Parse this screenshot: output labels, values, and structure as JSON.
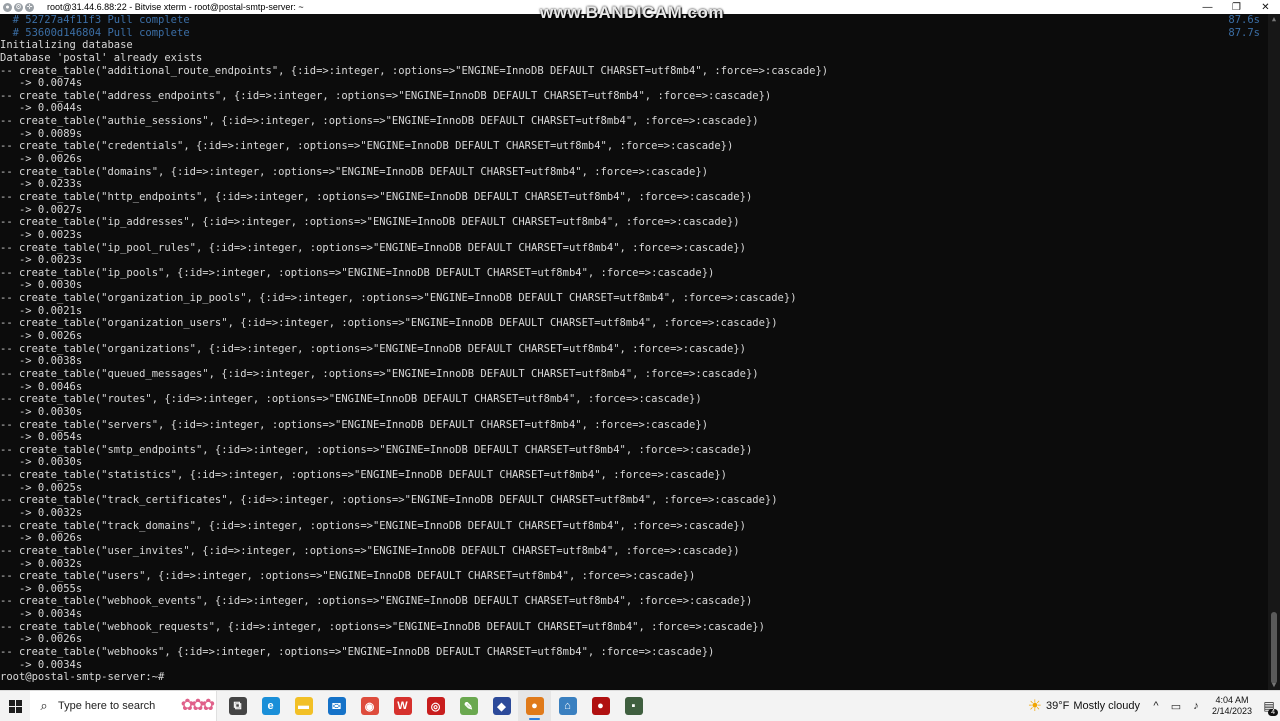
{
  "window": {
    "title": "root@31.44.6.88:22 - Bitvise xterm - root@postal-smtp-server: ~",
    "minimize": "—",
    "restore": "❐",
    "close": "✕"
  },
  "watermark": "www.BANDICAM.com",
  "terminal": {
    "lines": [
      {
        "text": "  # 52727a4f11f3 Pull complete",
        "dim": true,
        "right": "87.6s"
      },
      {
        "text": "  # 53600d146804 Pull complete",
        "dim": true,
        "right": "87.7s"
      },
      {
        "text": "Initializing database"
      },
      {
        "text": "Database 'postal' already exists"
      },
      {
        "text": "-- create_table(\"additional_route_endpoints\", {:id=>:integer, :options=>\"ENGINE=InnoDB DEFAULT CHARSET=utf8mb4\", :force=>:cascade})"
      },
      {
        "text": "   -> 0.0074s"
      },
      {
        "text": "-- create_table(\"address_endpoints\", {:id=>:integer, :options=>\"ENGINE=InnoDB DEFAULT CHARSET=utf8mb4\", :force=>:cascade})"
      },
      {
        "text": "   -> 0.0044s"
      },
      {
        "text": "-- create_table(\"authie_sessions\", {:id=>:integer, :options=>\"ENGINE=InnoDB DEFAULT CHARSET=utf8mb4\", :force=>:cascade})"
      },
      {
        "text": "   -> 0.0089s"
      },
      {
        "text": "-- create_table(\"credentials\", {:id=>:integer, :options=>\"ENGINE=InnoDB DEFAULT CHARSET=utf8mb4\", :force=>:cascade})"
      },
      {
        "text": "   -> 0.0026s"
      },
      {
        "text": "-- create_table(\"domains\", {:id=>:integer, :options=>\"ENGINE=InnoDB DEFAULT CHARSET=utf8mb4\", :force=>:cascade})"
      },
      {
        "text": "   -> 0.0233s"
      },
      {
        "text": "-- create_table(\"http_endpoints\", {:id=>:integer, :options=>\"ENGINE=InnoDB DEFAULT CHARSET=utf8mb4\", :force=>:cascade})"
      },
      {
        "text": "   -> 0.0027s"
      },
      {
        "text": "-- create_table(\"ip_addresses\", {:id=>:integer, :options=>\"ENGINE=InnoDB DEFAULT CHARSET=utf8mb4\", :force=>:cascade})"
      },
      {
        "text": "   -> 0.0023s"
      },
      {
        "text": "-- create_table(\"ip_pool_rules\", {:id=>:integer, :options=>\"ENGINE=InnoDB DEFAULT CHARSET=utf8mb4\", :force=>:cascade})"
      },
      {
        "text": "   -> 0.0023s"
      },
      {
        "text": "-- create_table(\"ip_pools\", {:id=>:integer, :options=>\"ENGINE=InnoDB DEFAULT CHARSET=utf8mb4\", :force=>:cascade})"
      },
      {
        "text": "   -> 0.0030s"
      },
      {
        "text": "-- create_table(\"organization_ip_pools\", {:id=>:integer, :options=>\"ENGINE=InnoDB DEFAULT CHARSET=utf8mb4\", :force=>:cascade})"
      },
      {
        "text": "   -> 0.0021s"
      },
      {
        "text": "-- create_table(\"organization_users\", {:id=>:integer, :options=>\"ENGINE=InnoDB DEFAULT CHARSET=utf8mb4\", :force=>:cascade})"
      },
      {
        "text": "   -> 0.0026s"
      },
      {
        "text": "-- create_table(\"organizations\", {:id=>:integer, :options=>\"ENGINE=InnoDB DEFAULT CHARSET=utf8mb4\", :force=>:cascade})"
      },
      {
        "text": "   -> 0.0038s"
      },
      {
        "text": "-- create_table(\"queued_messages\", {:id=>:integer, :options=>\"ENGINE=InnoDB DEFAULT CHARSET=utf8mb4\", :force=>:cascade})"
      },
      {
        "text": "   -> 0.0046s"
      },
      {
        "text": "-- create_table(\"routes\", {:id=>:integer, :options=>\"ENGINE=InnoDB DEFAULT CHARSET=utf8mb4\", :force=>:cascade})"
      },
      {
        "text": "   -> 0.0030s"
      },
      {
        "text": "-- create_table(\"servers\", {:id=>:integer, :options=>\"ENGINE=InnoDB DEFAULT CHARSET=utf8mb4\", :force=>:cascade})"
      },
      {
        "text": "   -> 0.0054s"
      },
      {
        "text": "-- create_table(\"smtp_endpoints\", {:id=>:integer, :options=>\"ENGINE=InnoDB DEFAULT CHARSET=utf8mb4\", :force=>:cascade})"
      },
      {
        "text": "   -> 0.0030s"
      },
      {
        "text": "-- create_table(\"statistics\", {:id=>:integer, :options=>\"ENGINE=InnoDB DEFAULT CHARSET=utf8mb4\", :force=>:cascade})"
      },
      {
        "text": "   -> 0.0025s"
      },
      {
        "text": "-- create_table(\"track_certificates\", {:id=>:integer, :options=>\"ENGINE=InnoDB DEFAULT CHARSET=utf8mb4\", :force=>:cascade})"
      },
      {
        "text": "   -> 0.0032s"
      },
      {
        "text": "-- create_table(\"track_domains\", {:id=>:integer, :options=>\"ENGINE=InnoDB DEFAULT CHARSET=utf8mb4\", :force=>:cascade})"
      },
      {
        "text": "   -> 0.0026s"
      },
      {
        "text": "-- create_table(\"user_invites\", {:id=>:integer, :options=>\"ENGINE=InnoDB DEFAULT CHARSET=utf8mb4\", :force=>:cascade})"
      },
      {
        "text": "   -> 0.0032s"
      },
      {
        "text": "-- create_table(\"users\", {:id=>:integer, :options=>\"ENGINE=InnoDB DEFAULT CHARSET=utf8mb4\", :force=>:cascade})"
      },
      {
        "text": "   -> 0.0055s"
      },
      {
        "text": "-- create_table(\"webhook_events\", {:id=>:integer, :options=>\"ENGINE=InnoDB DEFAULT CHARSET=utf8mb4\", :force=>:cascade})"
      },
      {
        "text": "   -> 0.0034s"
      },
      {
        "text": "-- create_table(\"webhook_requests\", {:id=>:integer, :options=>\"ENGINE=InnoDB DEFAULT CHARSET=utf8mb4\", :force=>:cascade})"
      },
      {
        "text": "   -> 0.0026s"
      },
      {
        "text": "-- create_table(\"webhooks\", {:id=>:integer, :options=>\"ENGINE=InnoDB DEFAULT CHARSET=utf8mb4\", :force=>:cascade})"
      },
      {
        "text": "   -> 0.0034s"
      },
      {
        "text": "root@postal-smtp-server:~# "
      }
    ]
  },
  "taskbar": {
    "search_placeholder": "Type here to search",
    "apps": [
      {
        "icon": "task-view-icon",
        "glyph": "⧉",
        "color": "#444444"
      },
      {
        "icon": "edge-icon",
        "glyph": "e",
        "color": "#1a8fd8"
      },
      {
        "icon": "file-explorer-icon",
        "glyph": "▬",
        "color": "#f2c026"
      },
      {
        "icon": "mail-icon",
        "glyph": "✉",
        "color": "#1572c8"
      },
      {
        "icon": "chrome-icon",
        "glyph": "◉",
        "color": "#de4c3c"
      },
      {
        "icon": "wps-office-icon",
        "glyph": "W",
        "color": "#d6312d"
      },
      {
        "icon": "red-circle-app-icon",
        "glyph": "◎",
        "color": "#c81e1e"
      },
      {
        "icon": "notepad-plus-icon",
        "glyph": "✎",
        "color": "#6aa84f"
      },
      {
        "icon": "bitvise-icon",
        "glyph": "◆",
        "color": "#2c4a9a"
      },
      {
        "icon": "bandicam-icon",
        "glyph": "●",
        "color": "#e07a1a",
        "active": true
      },
      {
        "icon": "network-app-icon",
        "glyph": "⌂",
        "color": "#3a80c0"
      },
      {
        "icon": "record-icon",
        "glyph": "●",
        "color": "#b01010"
      },
      {
        "icon": "terminal-app-icon",
        "glyph": "▪",
        "color": "#3f5f3f"
      }
    ],
    "weather": {
      "temp": "39°F",
      "condition": "Mostly cloudy"
    },
    "tray_chevron": "^",
    "clock": {
      "time": "4:04 AM",
      "date": "2/14/2023"
    },
    "notification_count": "4"
  }
}
